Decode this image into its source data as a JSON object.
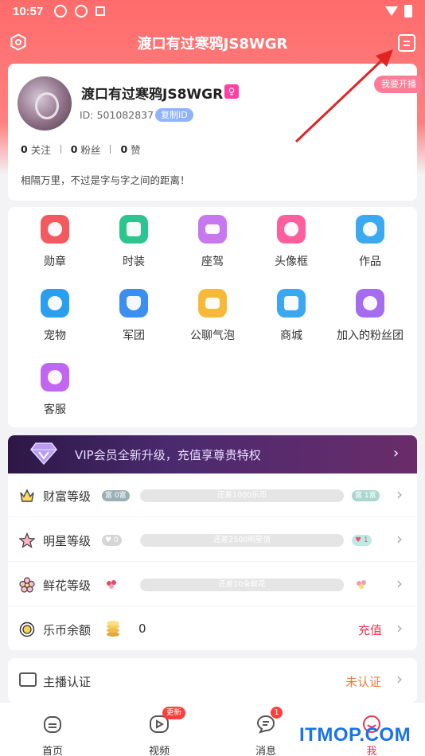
{
  "status_bar": {
    "time": "10:57"
  },
  "header": {
    "title": "渡口有过寒鸦JS8WGR"
  },
  "profile": {
    "nickname": "渡口有过寒鸦JS8WGR",
    "gender_badge": "♀",
    "id_text": "ID: 501082837",
    "copy_id_label": "复制ID",
    "live_button": "我要开播",
    "stats": [
      {
        "count": "0",
        "label": "关注"
      },
      {
        "count": "0",
        "label": "粉丝"
      },
      {
        "count": "0",
        "label": "赞"
      }
    ],
    "bio": "相隔万里，不过是字与字之间的距离！"
  },
  "features": [
    {
      "label": "勋章",
      "icon": "medal-icon",
      "color": "#f25a5f"
    },
    {
      "label": "时装",
      "icon": "shirt-icon",
      "color": "#2bc58f"
    },
    {
      "label": "座驾",
      "icon": "car-icon",
      "color": "#c777f0"
    },
    {
      "label": "头像框",
      "icon": "avatar-frame-icon",
      "color": "#ff5e9e"
    },
    {
      "label": "作品",
      "icon": "star-icon",
      "color": "#3ba9f2"
    },
    {
      "label": "宠物",
      "icon": "pet-icon",
      "color": "#2b9ef0"
    },
    {
      "label": "军团",
      "icon": "shield-icon",
      "color": "#3b8ff0"
    },
    {
      "label": "公聊气泡",
      "icon": "chat-bubble-icon",
      "color": "#f7b93a"
    },
    {
      "label": "商城",
      "icon": "shop-icon",
      "color": "#3aa8f0"
    },
    {
      "label": "加入的粉丝团",
      "icon": "fan-group-icon",
      "color": "#a56cf0"
    },
    {
      "label": "客服",
      "icon": "headset-icon",
      "color": "#c066f0"
    }
  ],
  "vip": {
    "text": "VIP会员全新升级，充值享尊贵特权"
  },
  "levels": [
    {
      "label": "财富等级",
      "icon": "crown-icon",
      "left_pill": "富 0富",
      "progress_text": "还差1000乐币",
      "right_pill": "富 1富"
    },
    {
      "label": "明星等级",
      "icon": "star-outline-icon",
      "left_pill": "♥ 0",
      "progress_text": "还差2500明星值",
      "right_pill": "♥ 1"
    },
    {
      "label": "鲜花等级",
      "icon": "flower-icon",
      "progress_text": "还差10朵鲜花"
    }
  ],
  "coins": {
    "label": "乐币余额",
    "amount": "0",
    "recharge": "充值"
  },
  "certification": {
    "label": "主播认证",
    "status": "未认证"
  },
  "nav": {
    "items": [
      {
        "label": "首页",
        "icon": "home-icon"
      },
      {
        "label": "视频",
        "icon": "video-icon"
      },
      {
        "label": "消息",
        "icon": "message-icon"
      },
      {
        "label": "我",
        "icon": "me-icon"
      }
    ],
    "video_badge": "更新",
    "message_badge": "1"
  },
  "watermark": "ITMOP.COM"
}
